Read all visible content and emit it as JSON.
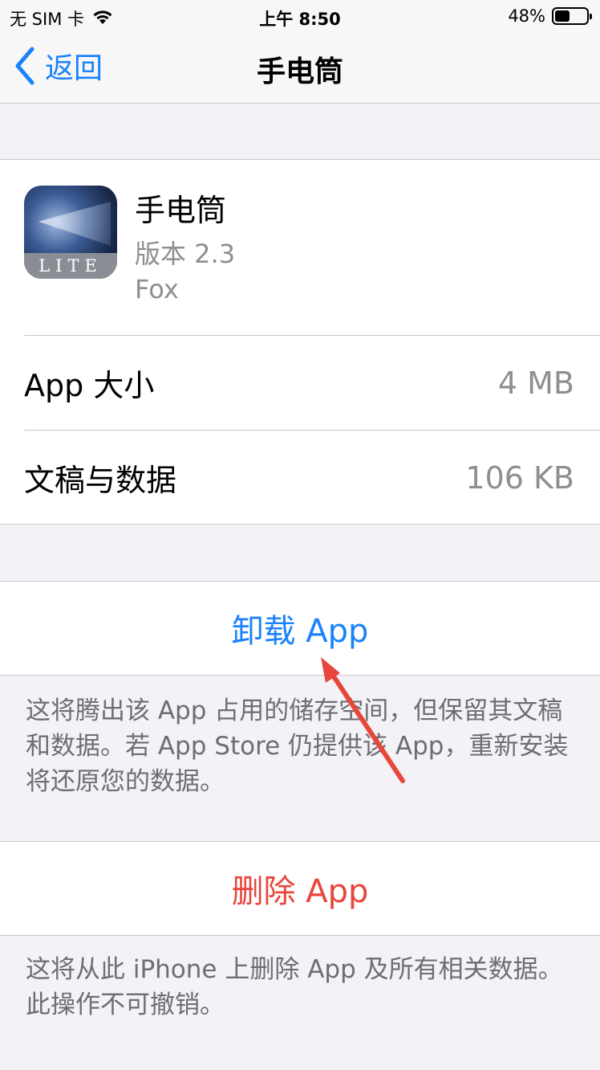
{
  "status_bar": {
    "carrier": "无 SIM 卡",
    "time": "上午 8:50",
    "battery_percent": "48%",
    "battery_level": 0.48
  },
  "nav": {
    "back_label": "返回",
    "title": "手电筒"
  },
  "app": {
    "name": "手电筒",
    "version": "版本 2.3",
    "developer": "Fox",
    "icon_text": "LITE"
  },
  "rows": [
    {
      "label": "App 大小",
      "value": "4 MB"
    },
    {
      "label": "文稿与数据",
      "value": "106 KB"
    }
  ],
  "offload": {
    "label": "卸载 App",
    "footnote": "这将腾出该 App 占用的储存空间，但保留其文稿和数据。若 App Store 仍提供该 App，重新安装将还原您的数据。"
  },
  "delete": {
    "label": "删除 App",
    "footnote": "这将从此 iPhone 上删除 App 及所有相关数据。此操作不可撤销。"
  },
  "colors": {
    "accent": "#1a82fb",
    "destructive": "#e8453c",
    "annotation": "#e8453c"
  }
}
